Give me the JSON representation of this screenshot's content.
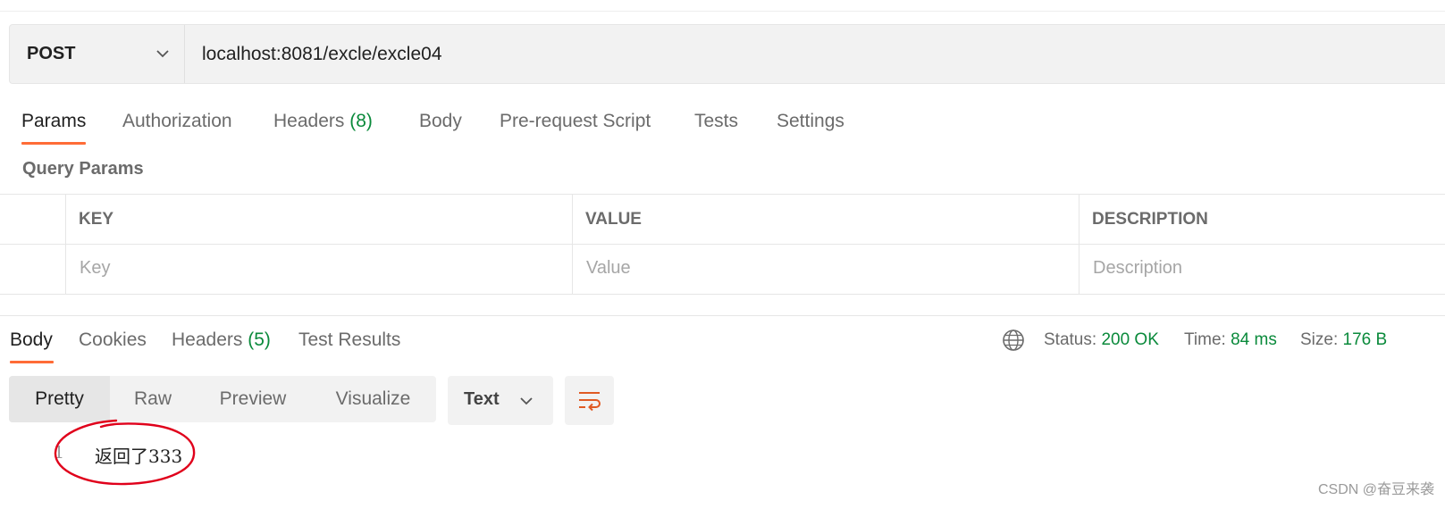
{
  "request": {
    "method": "POST",
    "url": "localhost:8081/excle/excle04"
  },
  "request_tabs": [
    {
      "label": "Params"
    },
    {
      "label": "Authorization"
    },
    {
      "label": "Headers",
      "count": "(8)"
    },
    {
      "label": "Body"
    },
    {
      "label": "Pre-request Script"
    },
    {
      "label": "Tests"
    },
    {
      "label": "Settings"
    }
  ],
  "query_params": {
    "title": "Query Params",
    "columns": [
      "KEY",
      "VALUE",
      "DESCRIPTION"
    ],
    "placeholders": {
      "key": "Key",
      "value": "Value",
      "description": "Description"
    }
  },
  "response_tabs": [
    {
      "label": "Body"
    },
    {
      "label": "Cookies"
    },
    {
      "label": "Headers",
      "count": "(5)"
    },
    {
      "label": "Test Results"
    }
  ],
  "response_meta": {
    "status_label": "Status:",
    "status_value": "200 OK",
    "time_label": "Time:",
    "time_value": "84 ms",
    "size_label": "Size:",
    "size_value": "176 B"
  },
  "view_modes": [
    "Pretty",
    "Raw",
    "Preview",
    "Visualize"
  ],
  "format": {
    "selected": "Text"
  },
  "response_body": [
    {
      "line": "1",
      "text": "返回了333"
    }
  ],
  "watermark": "CSDN @奋豆来袭",
  "colors": {
    "accent": "#ff6c37",
    "success": "#0a8a3b",
    "annotation": "#e0001b"
  },
  "icons": [
    "chevron-down-icon",
    "globe-icon",
    "wrap-lines-icon"
  ]
}
